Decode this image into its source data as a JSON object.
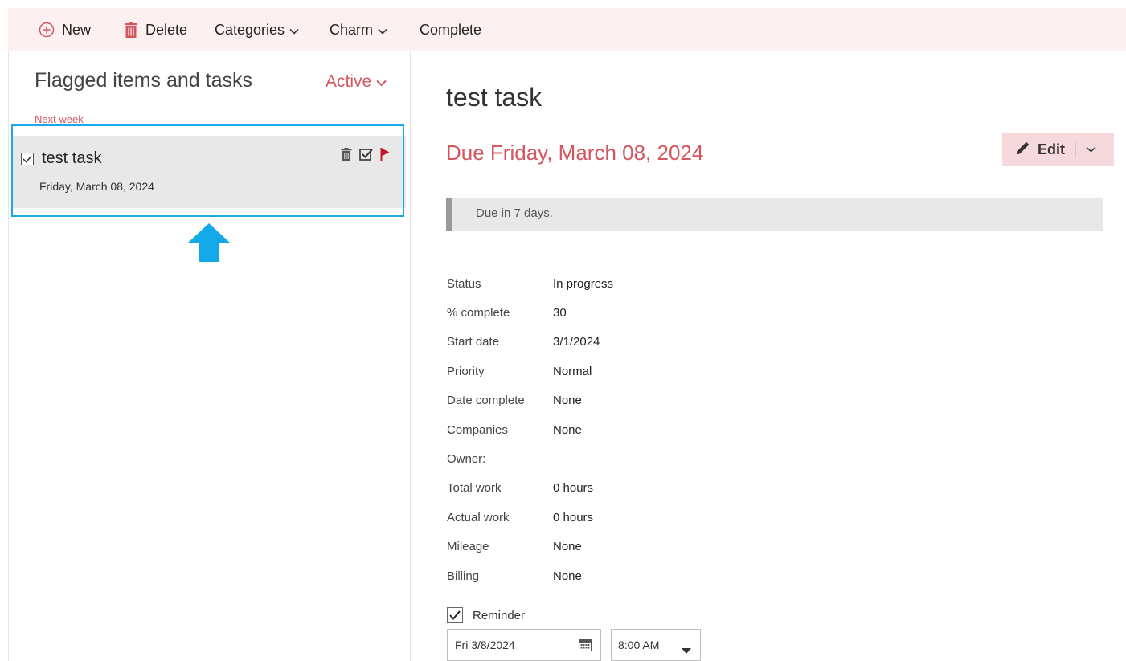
{
  "toolbar": {
    "new_label": "New",
    "delete_label": "Delete",
    "categories_label": "Categories",
    "charm_label": "Charm",
    "complete_label": "Complete"
  },
  "list": {
    "title": "Flagged items and tasks",
    "filter": "Active",
    "group_label": "Next week",
    "items": [
      {
        "name": "test task",
        "date": "Friday, March 08, 2024",
        "checked": true
      }
    ]
  },
  "detail": {
    "title": "test task",
    "due": "Due Friday, March 08, 2024",
    "edit_label": "Edit",
    "notice": "Due in 7 days.",
    "props": [
      {
        "key": "Status",
        "value": "In progress"
      },
      {
        "key": "% complete",
        "value": "30"
      },
      {
        "key": "Start date",
        "value": "3/1/2024"
      },
      {
        "key": "Priority",
        "value": "Normal"
      },
      {
        "key": "Date complete",
        "value": "None"
      },
      {
        "key": "Companies",
        "value": "None"
      },
      {
        "key": "Owner:",
        "value": ""
      },
      {
        "key": "Total work",
        "value": "0 hours"
      },
      {
        "key": "Actual work",
        "value": "0 hours"
      },
      {
        "key": "Mileage",
        "value": "None"
      },
      {
        "key": "Billing",
        "value": "None"
      }
    ],
    "reminder_label": "Reminder",
    "reminder_checked": true,
    "reminder_date": "Fri 3/8/2024",
    "reminder_time": "8:00 AM"
  },
  "colors": {
    "accent": "#d4575f",
    "toolbar_bg": "#fcf0f0",
    "highlight": "#1aa8e6"
  },
  "icons": {
    "new": "plus-circle-icon",
    "delete": "trash-icon",
    "flag": "flag-icon",
    "calendar": "calendar-icon"
  }
}
